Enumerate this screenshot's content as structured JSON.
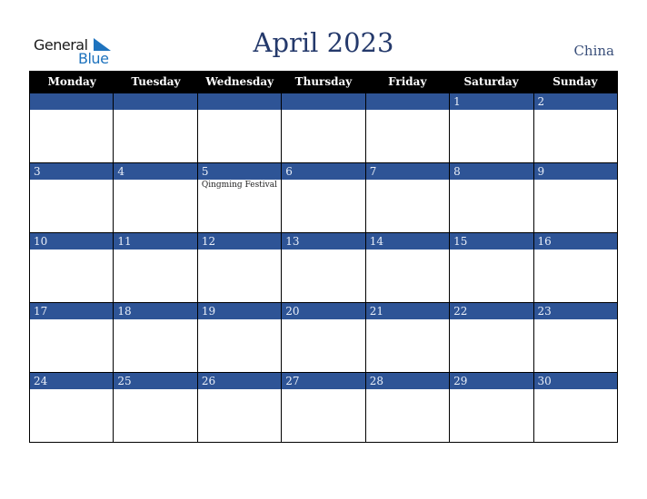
{
  "logo": {
    "line1": "General",
    "line2": "Blue"
  },
  "title": "April 2023",
  "country": "China",
  "colors": {
    "header_bg": "#000000",
    "date_bar": "#2e5496",
    "title": "#24396b",
    "logo_blue": "#1e73be"
  },
  "weekdays": [
    "Monday",
    "Tuesday",
    "Wednesday",
    "Thursday",
    "Friday",
    "Saturday",
    "Sunday"
  ],
  "weeks": [
    {
      "days": [
        {
          "date": ""
        },
        {
          "date": ""
        },
        {
          "date": ""
        },
        {
          "date": ""
        },
        {
          "date": ""
        },
        {
          "date": "1"
        },
        {
          "date": "2"
        }
      ]
    },
    {
      "days": [
        {
          "date": "3"
        },
        {
          "date": "4"
        },
        {
          "date": "5",
          "event": "Qingming Festival"
        },
        {
          "date": "6"
        },
        {
          "date": "7"
        },
        {
          "date": "8"
        },
        {
          "date": "9"
        }
      ]
    },
    {
      "days": [
        {
          "date": "10"
        },
        {
          "date": "11"
        },
        {
          "date": "12"
        },
        {
          "date": "13"
        },
        {
          "date": "14"
        },
        {
          "date": "15"
        },
        {
          "date": "16"
        }
      ]
    },
    {
      "days": [
        {
          "date": "17"
        },
        {
          "date": "18"
        },
        {
          "date": "19"
        },
        {
          "date": "20"
        },
        {
          "date": "21"
        },
        {
          "date": "22"
        },
        {
          "date": "23"
        }
      ]
    },
    {
      "days": [
        {
          "date": "24"
        },
        {
          "date": "25"
        },
        {
          "date": "26"
        },
        {
          "date": "27"
        },
        {
          "date": "28"
        },
        {
          "date": "29"
        },
        {
          "date": "30"
        }
      ]
    }
  ]
}
